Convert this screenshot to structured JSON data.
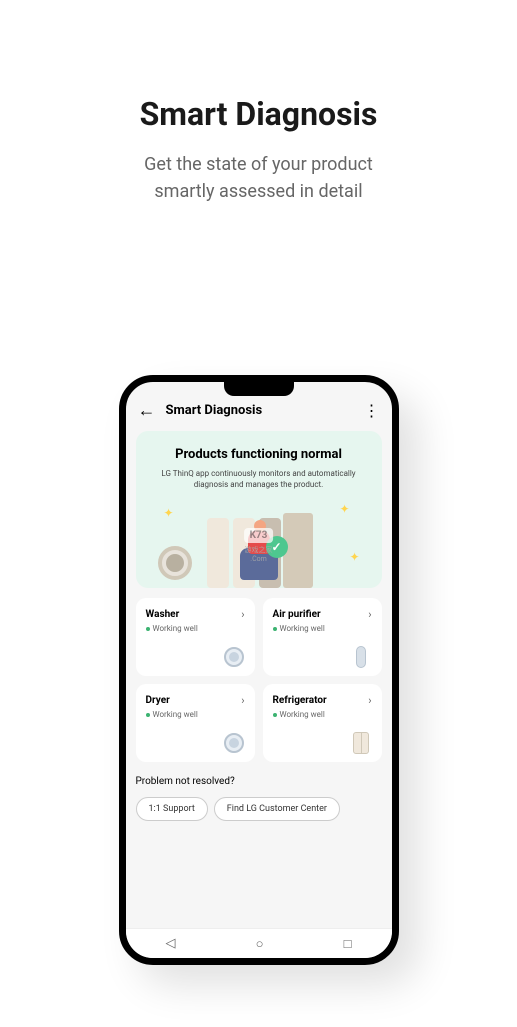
{
  "page": {
    "title": "Smart Diagnosis",
    "subtitle_line1": "Get the state of your product",
    "subtitle_line2": "smartly assessed in detail"
  },
  "app_bar": {
    "title": "Smart Diagnosis"
  },
  "hero": {
    "title": "Products functioning normal",
    "description": "LG ThinQ app continuously monitors and automatically diagnosis and manages the product."
  },
  "watermark": {
    "main": "K73",
    "sub_cn": "游戏之家",
    "sub_en": ".Com"
  },
  "products": [
    {
      "name": "Washer",
      "status": "Working well",
      "icon": "washer"
    },
    {
      "name": "Air purifier",
      "status": "Working well",
      "icon": "purifier"
    },
    {
      "name": "Dryer",
      "status": "Working well",
      "icon": "washer"
    },
    {
      "name": "Refrigerator",
      "status": "Working well",
      "icon": "fridge"
    }
  ],
  "footer": {
    "question": "Problem not resolved?",
    "btn_support": "1:1 Support",
    "btn_center": "Find LG Customer Center"
  }
}
